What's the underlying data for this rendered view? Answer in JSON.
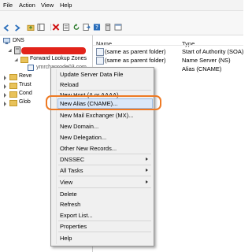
{
  "menubar": {
    "items": [
      "File",
      "Action",
      "View",
      "Help"
    ]
  },
  "toolbar": {
    "icons": [
      "back-icon",
      "forward-icon",
      "up-folder-icon",
      "show-hide-tree-icon",
      "delete-icon",
      "properties-icon",
      "refresh-icon",
      "export-icon",
      "help-icon",
      "server-data-icon",
      "new-record-icon"
    ]
  },
  "tree": {
    "root": "DNS",
    "forward_lookup": "Forward Lookup Zones",
    "zone": "ymrchanrode03.com",
    "partial": [
      "Reve",
      "Trust",
      "Cond",
      "Glob"
    ]
  },
  "list": {
    "headers": {
      "name": "Name",
      "type": "Type"
    },
    "rows": [
      {
        "name": "(same as parent folder)",
        "type": "Start of Authority (SOA)"
      },
      {
        "name": "(same as parent folder)",
        "type": "Name Server (NS)"
      },
      {
        "name": "",
        "type": "Alias (CNAME)"
      }
    ]
  },
  "context_menu": {
    "items": [
      "Update Server Data File",
      "Reload",
      "New Host (A or AAAA)...",
      "New Alias (CNAME)...",
      "New Mail Exchanger (MX)...",
      "New Domain...",
      "New Delegation...",
      "Other New Records...",
      "DNSSEC",
      "All Tasks",
      "View",
      "Delete",
      "Refresh",
      "Export List...",
      "Properties",
      "Help"
    ],
    "highlighted": "New Alias (CNAME)..."
  },
  "colors": {
    "highlight_outline": "#ee7a24",
    "redaction": "#e2231a",
    "menu_highlight": "#dbe8f8"
  }
}
